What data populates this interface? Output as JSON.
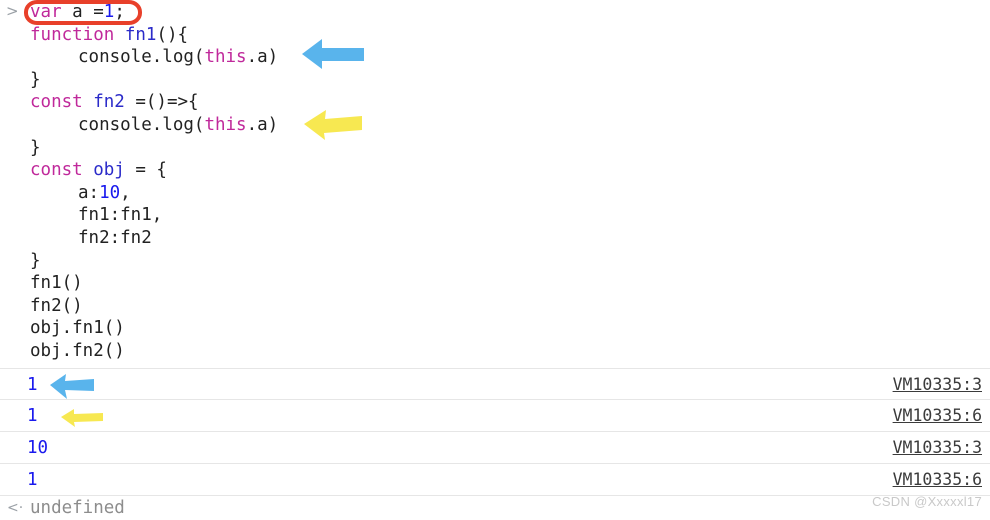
{
  "console": {
    "prompt_symbol": ">",
    "return_marker": "<·",
    "input_lines": [
      {
        "indent": 0,
        "tokens": [
          {
            "t": "var ",
            "c": "kw"
          },
          {
            "t": "a =",
            "c": "plain"
          },
          {
            "t": "1",
            "c": "num"
          },
          {
            "t": ";",
            "c": "plain"
          }
        ]
      },
      {
        "indent": 0,
        "tokens": [
          {
            "t": "function ",
            "c": "kw"
          },
          {
            "t": "fn1",
            "c": "fn"
          },
          {
            "t": "(){",
            "c": "plain"
          }
        ]
      },
      {
        "indent": 1,
        "tokens": [
          {
            "t": "console.log(",
            "c": "plain"
          },
          {
            "t": "this",
            "c": "this"
          },
          {
            "t": ".a)",
            "c": "plain"
          }
        ]
      },
      {
        "indent": 0,
        "tokens": [
          {
            "t": "}",
            "c": "plain"
          }
        ]
      },
      {
        "indent": 0,
        "tokens": [
          {
            "t": "const ",
            "c": "kw"
          },
          {
            "t": "fn2",
            "c": "fn"
          },
          {
            "t": " =()=>{",
            "c": "plain"
          }
        ]
      },
      {
        "indent": 1,
        "tokens": [
          {
            "t": "console.log(",
            "c": "plain"
          },
          {
            "t": "this",
            "c": "this"
          },
          {
            "t": ".a)",
            "c": "plain"
          }
        ]
      },
      {
        "indent": 0,
        "tokens": [
          {
            "t": "}",
            "c": "plain"
          }
        ]
      },
      {
        "indent": 0,
        "tokens": [
          {
            "t": "const ",
            "c": "kw"
          },
          {
            "t": "obj",
            "c": "fn"
          },
          {
            "t": " = {",
            "c": "plain"
          }
        ]
      },
      {
        "indent": 1,
        "tokens": [
          {
            "t": "a:",
            "c": "plain"
          },
          {
            "t": "10",
            "c": "num"
          },
          {
            "t": ",",
            "c": "plain"
          }
        ]
      },
      {
        "indent": 1,
        "tokens": [
          {
            "t": "fn1:fn1,",
            "c": "plain"
          }
        ]
      },
      {
        "indent": 1,
        "tokens": [
          {
            "t": "fn2:fn2",
            "c": "plain"
          }
        ]
      },
      {
        "indent": 0,
        "tokens": [
          {
            "t": "}",
            "c": "plain"
          }
        ]
      },
      {
        "indent": 0,
        "tokens": [
          {
            "t": "fn1()",
            "c": "plain"
          }
        ]
      },
      {
        "indent": 0,
        "tokens": [
          {
            "t": "fn2()",
            "c": "plain"
          }
        ]
      },
      {
        "indent": 0,
        "tokens": [
          {
            "t": "obj.fn1()",
            "c": "plain"
          }
        ]
      },
      {
        "indent": 0,
        "tokens": [
          {
            "t": "obj.fn2()",
            "c": "plain"
          }
        ]
      }
    ],
    "results": [
      {
        "value": "1",
        "source": "VM10335:3",
        "arrow": "blue"
      },
      {
        "value": "1",
        "source": "VM10335:6",
        "arrow": "yellow"
      },
      {
        "value": "10",
        "source": "VM10335:3",
        "arrow": "none"
      },
      {
        "value": "1",
        "source": "VM10335:6",
        "arrow": "none"
      }
    ],
    "returned_value": "undefined"
  },
  "annotations": {
    "highlight_oval": {
      "target_text": "var a =1;",
      "color": "#e8402a"
    },
    "arrow_blue_color": "#59b4ec",
    "arrow_yellow_color": "#f7e851"
  },
  "watermark": {
    "text": "CSDN @Xxxxxl17"
  },
  "colors": {
    "keyword": "#c0299b",
    "identifier": "#2b2bc9",
    "number": "#1a1aee",
    "plain": "#222222",
    "result": "#1a1aee",
    "source_link": "#3b3b3b",
    "undefined": "#8d8d8d",
    "row_divider": "#e6e6e6",
    "background": "#ffffff"
  }
}
